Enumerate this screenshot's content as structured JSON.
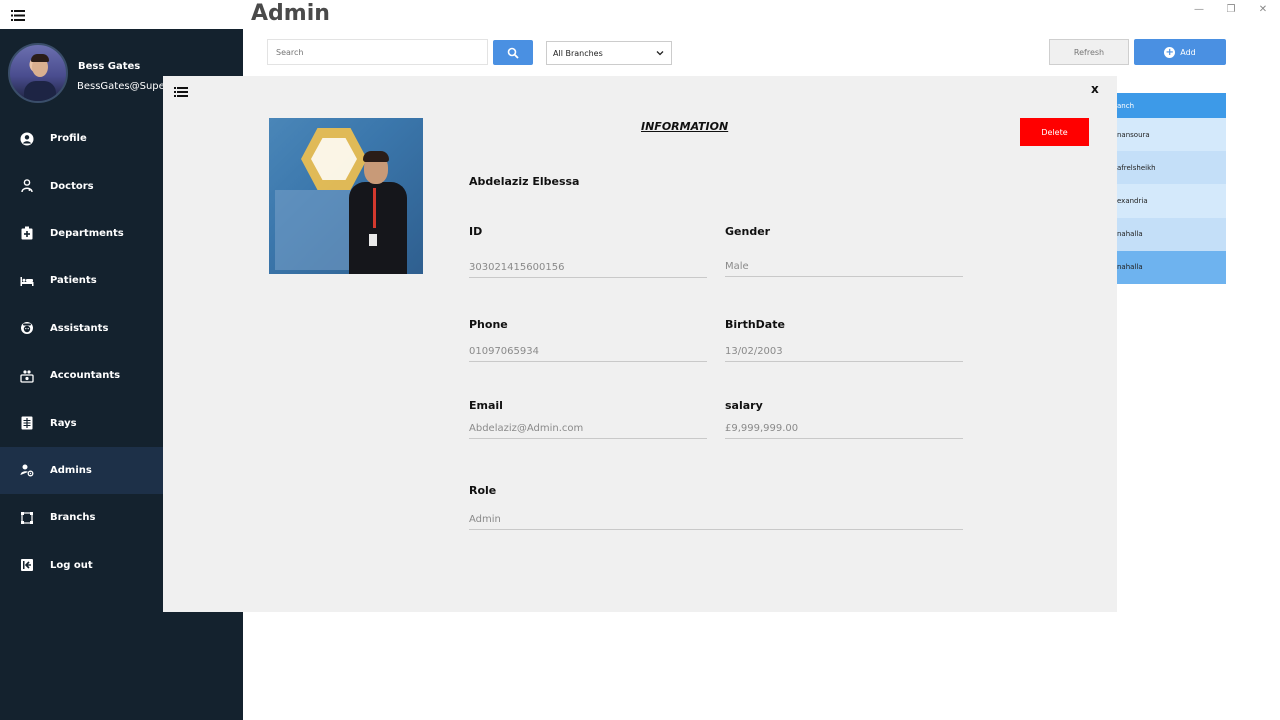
{
  "window": {
    "title": "Admin",
    "min": "—",
    "restore": "❐",
    "close": "✕"
  },
  "sidebar": {
    "user_name": "Bess Gates",
    "user_email": "BessGates@SuperA",
    "items": [
      {
        "label": "Profile",
        "icon": "user-circle-icon"
      },
      {
        "label": "Doctors",
        "icon": "doctor-icon"
      },
      {
        "label": "Departments",
        "icon": "first-aid-icon"
      },
      {
        "label": "Patients",
        "icon": "bed-icon"
      },
      {
        "label": "Assistants",
        "icon": "assistant-icon"
      },
      {
        "label": "Accountants",
        "icon": "money-icon"
      },
      {
        "label": "Rays",
        "icon": "xray-icon"
      },
      {
        "label": "Admins",
        "icon": "admin-gear-icon"
      },
      {
        "label": "Branchs",
        "icon": "branch-icon"
      },
      {
        "label": "Log out",
        "icon": "logout-icon"
      }
    ],
    "active_index": 7
  },
  "toolbar": {
    "search_placeholder": "Search",
    "branch_select_value": "All Branches",
    "refresh_label": "Refresh",
    "add_label": "Add"
  },
  "bg_table": {
    "header": "anch",
    "rows": [
      "nansoura",
      "afrelsheikh",
      "exandria",
      "nahalla",
      "nahalla"
    ]
  },
  "modal": {
    "close_label": "x",
    "title": "INFORMATION",
    "delete_label": "Delete",
    "full_name": "Abdelaziz Elbessa",
    "fields": {
      "id_label": "ID",
      "id_value": "303021415600156",
      "gender_label": "Gender",
      "gender_value": "Male",
      "phone_label": "Phone",
      "phone_value": "01097065934",
      "birth_label": "BirthDate",
      "birth_value": "13/02/2003",
      "email_label": "Email",
      "email_value": "Abdelaziz@Admin.com",
      "salary_label": "salary",
      "salary_value": "£9,999,999.00",
      "role_label": "Role",
      "role_value": "Admin"
    }
  },
  "colors": {
    "sidebar_bg": "#14222e",
    "accent_blue": "#4a90e2",
    "delete_red": "#ff0000",
    "modal_bg": "#f0f0f0"
  }
}
